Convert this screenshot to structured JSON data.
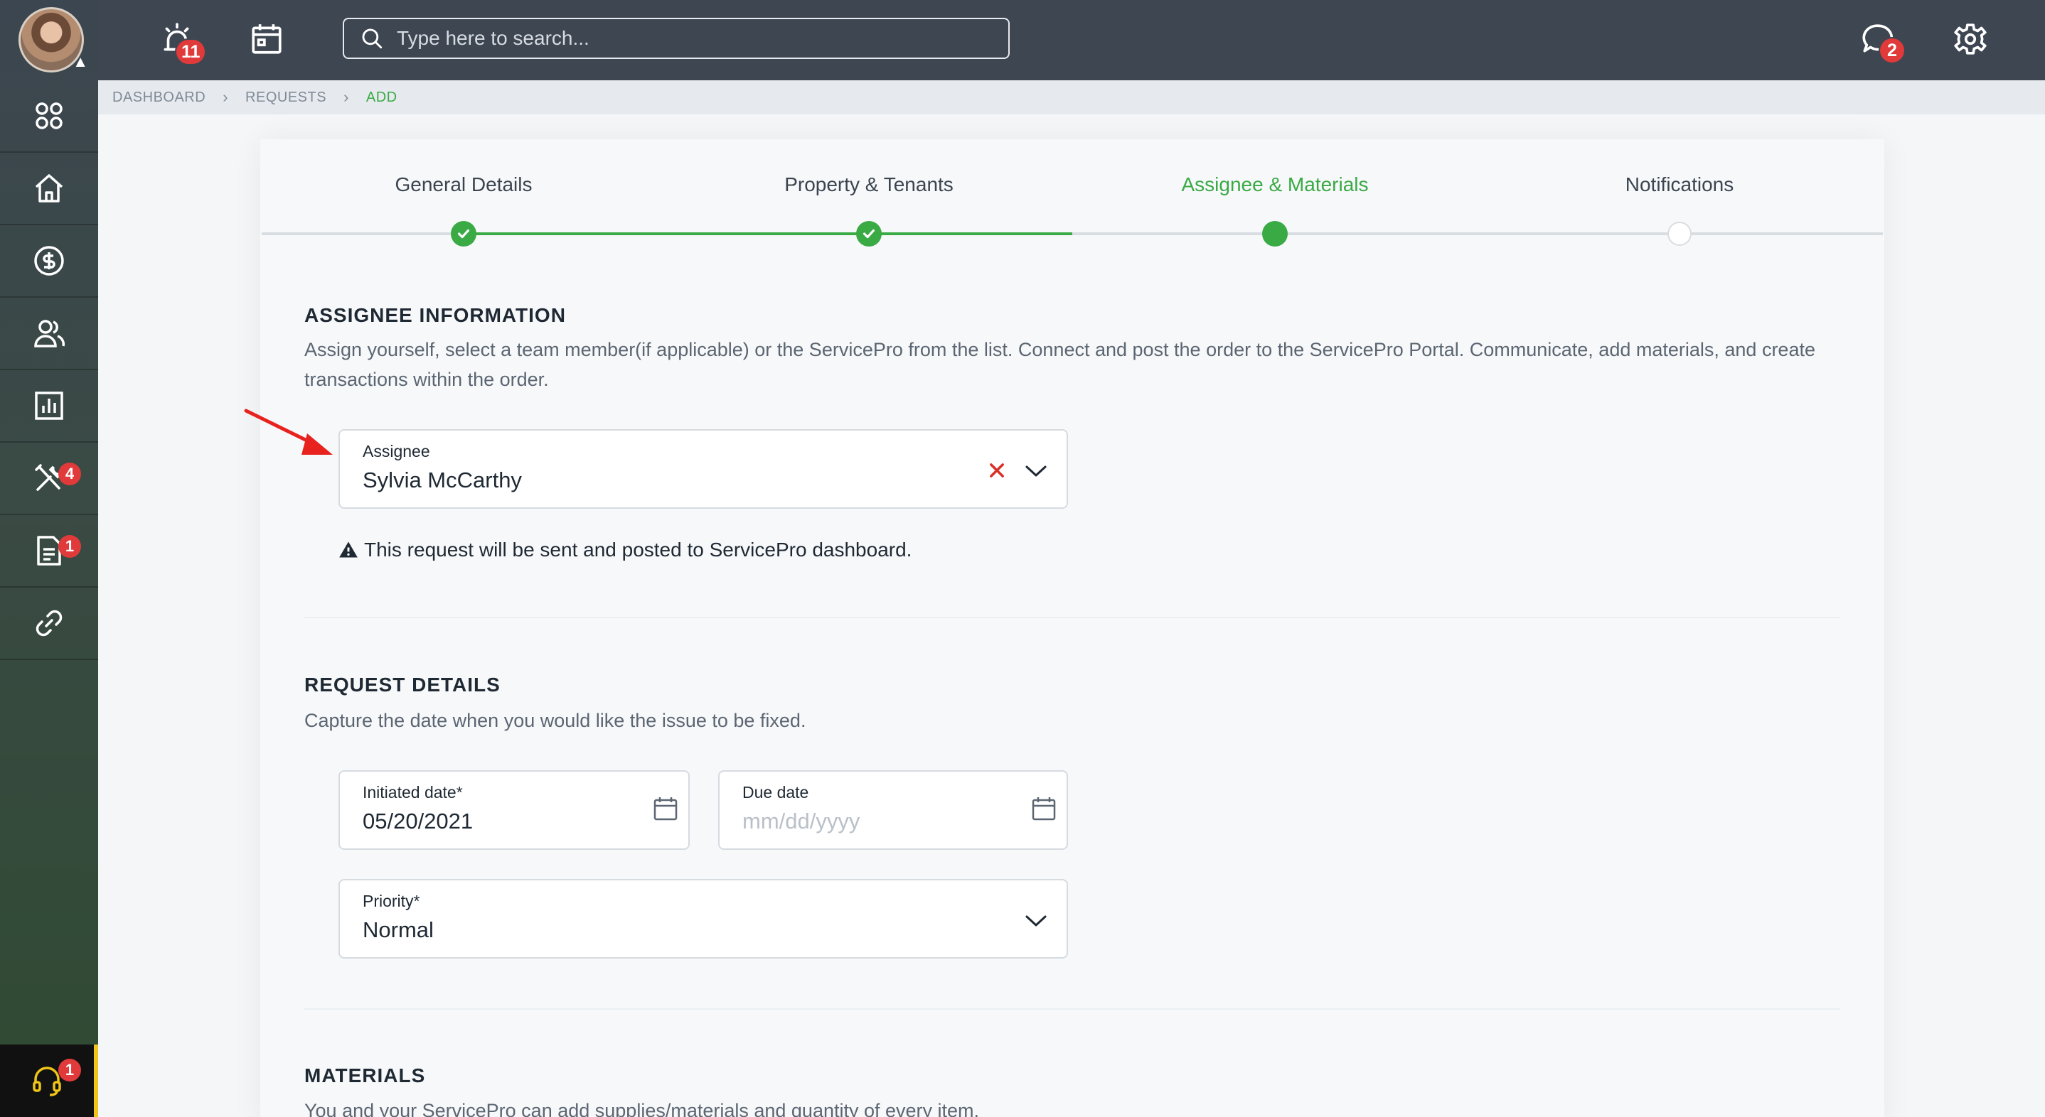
{
  "topbar": {
    "alerts_badge": "11",
    "messages_badge": "2",
    "search_placeholder": "Type here to search..."
  },
  "sidebar": {
    "items": [
      {
        "icon": "apps-grid-icon",
        "badge": ""
      },
      {
        "icon": "home-icon",
        "badge": ""
      },
      {
        "icon": "dollar-icon",
        "badge": ""
      },
      {
        "icon": "users-icon",
        "badge": ""
      },
      {
        "icon": "reports-icon",
        "badge": ""
      },
      {
        "icon": "tools-icon",
        "badge": "4"
      },
      {
        "icon": "document-icon",
        "badge": "1"
      },
      {
        "icon": "link-icon",
        "badge": ""
      }
    ],
    "support_badge": "1"
  },
  "breadcrumb": {
    "items": [
      "DASHBOARD",
      "REQUESTS",
      "ADD"
    ]
  },
  "stepper": {
    "steps": [
      {
        "label": "General Details",
        "state": "done"
      },
      {
        "label": "Property & Tenants",
        "state": "done"
      },
      {
        "label": "Assignee & Materials",
        "state": "current"
      },
      {
        "label": "Notifications",
        "state": "todo"
      }
    ]
  },
  "assignee_section": {
    "title": "ASSIGNEE INFORMATION",
    "description": "Assign yourself, select a team member(if applicable) or the ServicePro from the list. Connect and post the order to the ServicePro Portal. Communicate, add materials, and create transactions within the order.",
    "assignee_label": "Assignee",
    "assignee_value": "Sylvia McCarthy",
    "notice": "This request will be sent and posted to ServicePro dashboard."
  },
  "request_section": {
    "title": "REQUEST DETAILS",
    "description": "Capture the date when you would like the issue to be fixed.",
    "initiated_label": "Initiated date*",
    "initiated_value": "05/20/2021",
    "due_label": "Due date",
    "due_placeholder": "mm/dd/yyyy",
    "priority_label": "Priority*",
    "priority_value": "Normal"
  },
  "materials_section": {
    "title": "MATERIALS",
    "description": "You and your ServicePro can add supplies/materials and quantity of every item."
  },
  "colors": {
    "accent": "#3aaa45",
    "badge": "#e03a3a",
    "topbar": "#3e4652",
    "danger": "#d93025"
  }
}
